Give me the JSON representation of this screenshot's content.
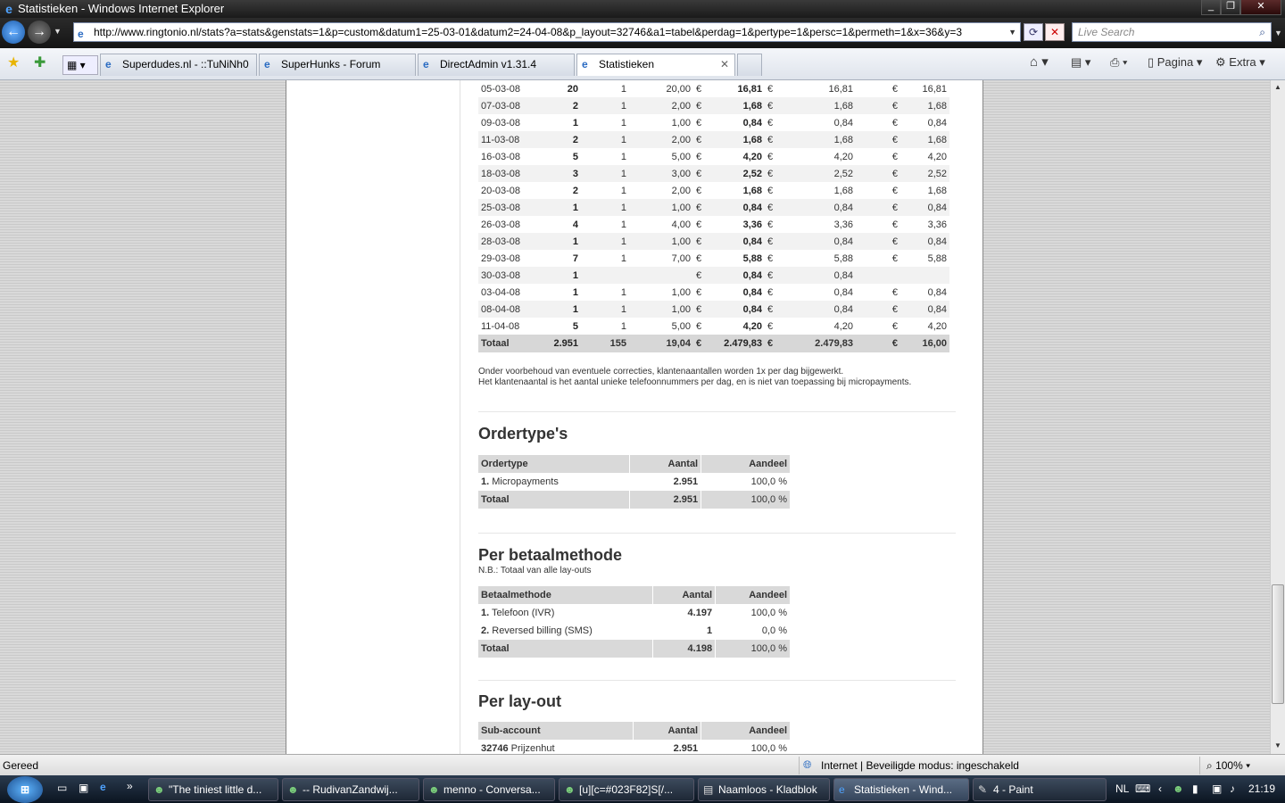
{
  "window": {
    "title": "Statistieken - Windows Internet Explorer"
  },
  "nav": {
    "url": "http://www.ringtonio.nl/stats?a=stats&genstats=1&p=custom&datum1=25-03-01&datum2=24-04-08&p_layout=32746&a1=tabel&perdag=1&pertype=1&persc=1&permeth=1&x=36&y=3",
    "search_placeholder": "Live Search"
  },
  "tabs": [
    {
      "label": "Superdudes.nl - ::TuNiNh0"
    },
    {
      "label": "SuperHunks - Forum"
    },
    {
      "label": "DirectAdmin v1.31.4"
    },
    {
      "label": "Statistieken"
    }
  ],
  "toolbar": {
    "pagina": "Pagina",
    "extra": "Extra"
  },
  "daily": {
    "rows": [
      {
        "d": "05-03-08",
        "a": "20",
        "k": "1",
        "p": "20,00",
        "e1": "€",
        "v1": "16,81",
        "e2": "€",
        "v2": "16,81",
        "e3": "€",
        "v3": "16,81"
      },
      {
        "d": "07-03-08",
        "a": "2",
        "k": "1",
        "p": "2,00",
        "e1": "€",
        "v1": "1,68",
        "e2": "€",
        "v2": "1,68",
        "e3": "€",
        "v3": "1,68"
      },
      {
        "d": "09-03-08",
        "a": "1",
        "k": "1",
        "p": "1,00",
        "e1": "€",
        "v1": "0,84",
        "e2": "€",
        "v2": "0,84",
        "e3": "€",
        "v3": "0,84"
      },
      {
        "d": "11-03-08",
        "a": "2",
        "k": "1",
        "p": "2,00",
        "e1": "€",
        "v1": "1,68",
        "e2": "€",
        "v2": "1,68",
        "e3": "€",
        "v3": "1,68"
      },
      {
        "d": "16-03-08",
        "a": "5",
        "k": "1",
        "p": "5,00",
        "e1": "€",
        "v1": "4,20",
        "e2": "€",
        "v2": "4,20",
        "e3": "€",
        "v3": "4,20"
      },
      {
        "d": "18-03-08",
        "a": "3",
        "k": "1",
        "p": "3,00",
        "e1": "€",
        "v1": "2,52",
        "e2": "€",
        "v2": "2,52",
        "e3": "€",
        "v3": "2,52"
      },
      {
        "d": "20-03-08",
        "a": "2",
        "k": "1",
        "p": "2,00",
        "e1": "€",
        "v1": "1,68",
        "e2": "€",
        "v2": "1,68",
        "e3": "€",
        "v3": "1,68"
      },
      {
        "d": "25-03-08",
        "a": "1",
        "k": "1",
        "p": "1,00",
        "e1": "€",
        "v1": "0,84",
        "e2": "€",
        "v2": "0,84",
        "e3": "€",
        "v3": "0,84"
      },
      {
        "d": "26-03-08",
        "a": "4",
        "k": "1",
        "p": "4,00",
        "e1": "€",
        "v1": "3,36",
        "e2": "€",
        "v2": "3,36",
        "e3": "€",
        "v3": "3,36"
      },
      {
        "d": "28-03-08",
        "a": "1",
        "k": "1",
        "p": "1,00",
        "e1": "€",
        "v1": "0,84",
        "e2": "€",
        "v2": "0,84",
        "e3": "€",
        "v3": "0,84"
      },
      {
        "d": "29-03-08",
        "a": "7",
        "k": "1",
        "p": "7,00",
        "e1": "€",
        "v1": "5,88",
        "e2": "€",
        "v2": "5,88",
        "e3": "€",
        "v3": "5,88"
      },
      {
        "d": "30-03-08",
        "a": "1",
        "k": "",
        "p": "",
        "e1": "€",
        "v1": "0,84",
        "e2": "€",
        "v2": "0,84",
        "e3": "",
        "v3": ""
      },
      {
        "d": "03-04-08",
        "a": "1",
        "k": "1",
        "p": "1,00",
        "e1": "€",
        "v1": "0,84",
        "e2": "€",
        "v2": "0,84",
        "e3": "€",
        "v3": "0,84"
      },
      {
        "d": "08-04-08",
        "a": "1",
        "k": "1",
        "p": "1,00",
        "e1": "€",
        "v1": "0,84",
        "e2": "€",
        "v2": "0,84",
        "e3": "€",
        "v3": "0,84"
      },
      {
        "d": "11-04-08",
        "a": "5",
        "k": "1",
        "p": "5,00",
        "e1": "€",
        "v1": "4,20",
        "e2": "€",
        "v2": "4,20",
        "e3": "€",
        "v3": "4,20"
      }
    ],
    "total": {
      "d": "Totaal",
      "a": "2.951",
      "k": "155",
      "p": "19,04",
      "e1": "€",
      "v1": "2.479,83",
      "e2": "€",
      "v2": "2.479,83",
      "e3": "€",
      "v3": "16,00"
    },
    "note1": "Onder voorbehoud van eventuele correcties, klantenaantallen worden 1x per dag bijgewerkt.",
    "note2": "Het klantenaantal is het aantal unieke telefoonnummers per dag, en is niet van toepassing bij micropayments."
  },
  "ordertypes": {
    "title": "Ordertype's",
    "headers": [
      "Ordertype",
      "Aantal",
      "Aandeel"
    ],
    "rows": [
      {
        "n": "1.",
        "name": "Micropayments",
        "aantal": "2.951",
        "aandeel": "100,0 %"
      }
    ],
    "total": {
      "name": "Totaal",
      "aantal": "2.951",
      "aandeel": "100,0 %"
    }
  },
  "betaal": {
    "title": "Per betaalmethode",
    "subtitle": "N.B.: Totaal van alle lay-outs",
    "headers": [
      "Betaalmethode",
      "Aantal",
      "Aandeel"
    ],
    "rows": [
      {
        "n": "1.",
        "name": "Telefoon (IVR)",
        "aantal": "4.197",
        "aandeel": "100,0 %"
      },
      {
        "n": "2.",
        "name": "Reversed billing (SMS)",
        "aantal": "1",
        "aandeel": "0,0 %"
      }
    ],
    "total": {
      "name": "Totaal",
      "aantal": "4.198",
      "aandeel": "100,0 %"
    }
  },
  "layout": {
    "title": "Per lay-out",
    "headers": [
      "Sub-account",
      "Aantal",
      "Aandeel"
    ],
    "rows": [
      {
        "n": "32746",
        "name": "Prijzenhut",
        "aantal": "2.951",
        "aandeel": "100,0 %"
      }
    ]
  },
  "status": {
    "left": "Gereed",
    "zone": "Internet | Beveiligde modus: ingeschakeld",
    "zoom": "100%"
  },
  "taskbar": {
    "items": [
      {
        "label": "\"The tiniest little d..."
      },
      {
        "label": "-- RudivanZandwij..."
      },
      {
        "label": "menno - Conversa..."
      },
      {
        "label": "[u][c=#023F82]S[/..."
      },
      {
        "label": "Naamloos - Kladblok"
      },
      {
        "label": "Statistieken - Wind..."
      },
      {
        "label": "4 - Paint"
      }
    ],
    "lang": "NL",
    "clock": "21:19"
  }
}
